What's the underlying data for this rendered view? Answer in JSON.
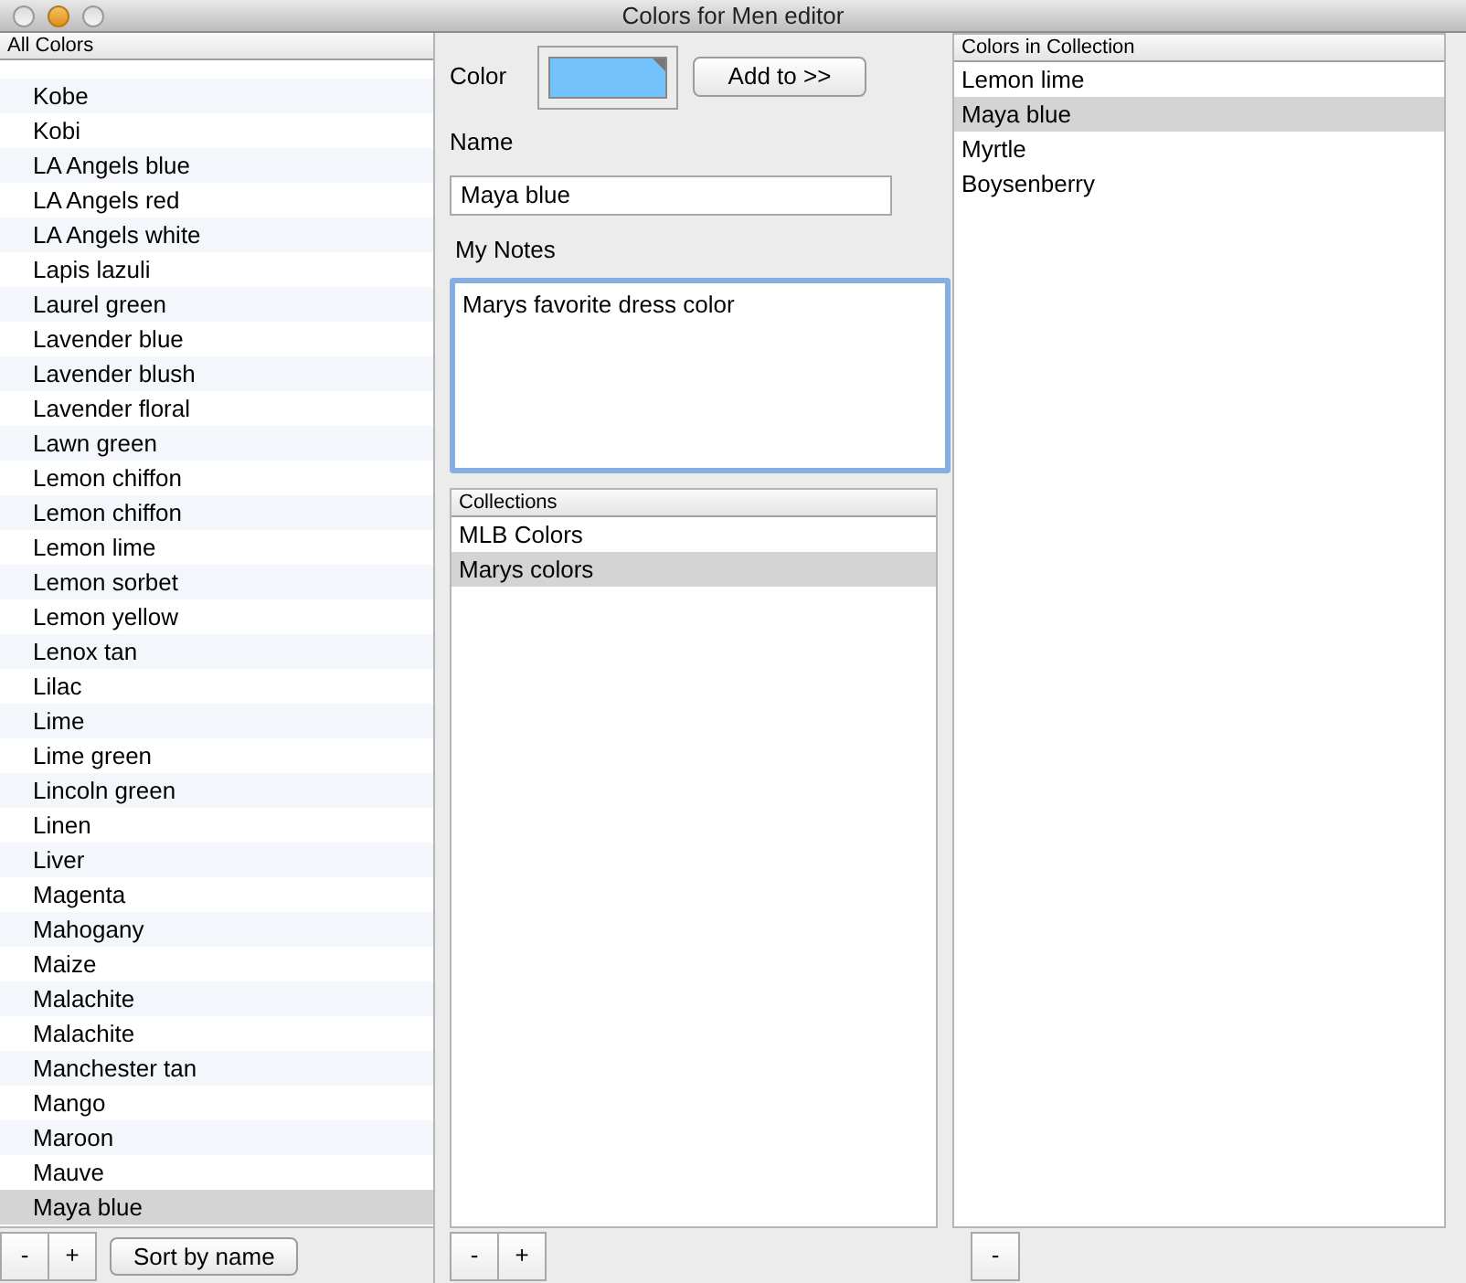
{
  "window": {
    "title": "Colors for Men editor"
  },
  "all_colors": {
    "header": "All Colors",
    "items": [
      {
        "label": "Kobe",
        "selected": false
      },
      {
        "label": "Kobi",
        "selected": false
      },
      {
        "label": "LA Angels blue",
        "selected": false
      },
      {
        "label": "LA Angels red",
        "selected": false
      },
      {
        "label": "LA Angels white",
        "selected": false
      },
      {
        "label": "Lapis lazuli",
        "selected": false
      },
      {
        "label": "Laurel green",
        "selected": false
      },
      {
        "label": "Lavender blue",
        "selected": false
      },
      {
        "label": "Lavender blush",
        "selected": false
      },
      {
        "label": "Lavender floral",
        "selected": false
      },
      {
        "label": "Lawn green",
        "selected": false
      },
      {
        "label": "Lemon chiffon",
        "selected": false
      },
      {
        "label": "Lemon chiffon",
        "selected": false
      },
      {
        "label": "Lemon lime",
        "selected": false
      },
      {
        "label": "Lemon sorbet",
        "selected": false
      },
      {
        "label": "Lemon yellow",
        "selected": false
      },
      {
        "label": "Lenox tan",
        "selected": false
      },
      {
        "label": "Lilac",
        "selected": false
      },
      {
        "label": "Lime",
        "selected": false
      },
      {
        "label": "Lime green",
        "selected": false
      },
      {
        "label": "Lincoln green",
        "selected": false
      },
      {
        "label": "Linen",
        "selected": false
      },
      {
        "label": "Liver",
        "selected": false
      },
      {
        "label": "Magenta",
        "selected": false
      },
      {
        "label": "Mahogany",
        "selected": false
      },
      {
        "label": "Maize",
        "selected": false
      },
      {
        "label": "Malachite",
        "selected": false
      },
      {
        "label": "Malachite",
        "selected": false
      },
      {
        "label": "Manchester tan",
        "selected": false
      },
      {
        "label": "Mango",
        "selected": false
      },
      {
        "label": "Maroon",
        "selected": false
      },
      {
        "label": "Mauve",
        "selected": false
      },
      {
        "label": "Maya blue",
        "selected": true
      }
    ],
    "buttons": [
      "-",
      "+",
      "Sort by name"
    ]
  },
  "editor": {
    "color_label": "Color",
    "color": "#73c2fb",
    "add_button": "Add to >>",
    "name_label": "Name",
    "name_value": "Maya blue",
    "notes_label": "My Notes",
    "notes_value": "Marys favorite dress color"
  },
  "collections": {
    "header": "Collections",
    "items": [
      {
        "label": "MLB Colors",
        "selected": false
      },
      {
        "label": "Marys colors",
        "selected": true
      }
    ],
    "buttons": [
      "-",
      "+"
    ]
  },
  "colors_in_collection": {
    "header": "Colors in Collection",
    "items": [
      {
        "label": "Lemon lime",
        "selected": false
      },
      {
        "label": "Maya blue",
        "selected": true
      },
      {
        "label": "Myrtle",
        "selected": false
      },
      {
        "label": "Boysenberry",
        "selected": false
      }
    ],
    "buttons": [
      "-"
    ]
  }
}
